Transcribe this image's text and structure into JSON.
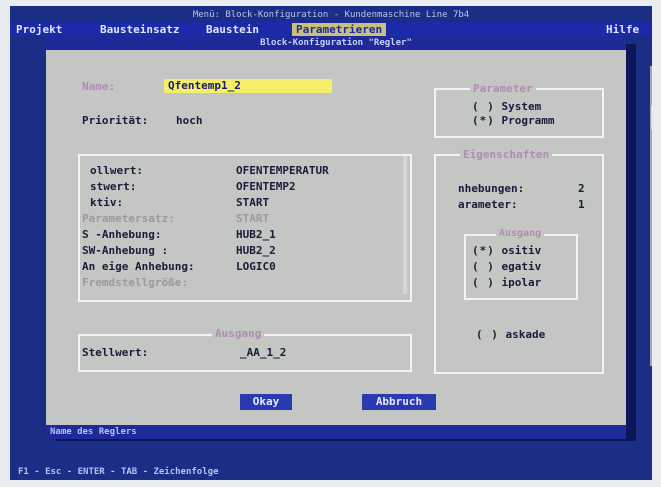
{
  "window": {
    "title": "Menü: Block-Konfiguration - Kundenmaschine Line 7b4"
  },
  "menubar": {
    "items": [
      "Projekt",
      "Bausteinsatz",
      "Baustein",
      "Parametrieren",
      "Hilfe"
    ]
  },
  "dialog": {
    "title": "Block-Konfiguration \"Regler\"",
    "name_label": "Name:",
    "name_value": "Qfentemp1_2",
    "prioritaet_label": "Priorität:",
    "prioritaet_value": "hoch",
    "parameter": {
      "title": "Parameter",
      "options": [
        {
          "mark": "( )",
          "label": "System"
        },
        {
          "mark": "(*)",
          "label": "Programm"
        }
      ]
    },
    "eigenschaften": {
      "title": "Eigenschaften",
      "rows": [
        {
          "label": "nhebungen:",
          "value": "2"
        },
        {
          "label": "arameter:",
          "value": "1"
        }
      ],
      "ausgang_title": "Ausgang",
      "ausgang_options": [
        {
          "mark": "(*)",
          "label": "ositiv"
        },
        {
          "mark": "( )",
          "label": "egativ"
        },
        {
          "mark": "( )",
          "label": "ipolar"
        }
      ],
      "kaskade": {
        "mark": "( )",
        "label": "askade"
      }
    },
    "eingang": {
      "rows": [
        {
          "label": "ollwert:",
          "value": "OFENTEMPERATUR",
          "dim": false
        },
        {
          "label": "stwert:",
          "value": "OFENTEMP2",
          "dim": false
        },
        {
          "label": "ktiv:",
          "value": "START",
          "dim": false
        },
        {
          "label": "Parametersatz:",
          "value": "START",
          "dim": true
        },
        {
          "label": "S -Anhebung:",
          "value": "HUB2_1",
          "dim": false
        },
        {
          "label": "SW-Anhebung :",
          "value": "HUB2_2",
          "dim": false
        },
        {
          "label": "An eige Anhebung:",
          "value": "LOGIC0",
          "dim": false
        },
        {
          "label": "Fremdstellgröße:",
          "value": "",
          "dim": true
        }
      ]
    },
    "ausgang_box": {
      "title": "Ausgang",
      "label": "Stellwert:",
      "value": "_AA_1_2"
    },
    "buttons": {
      "okay": "Okay",
      "abbruch": "Abbruch"
    },
    "status": "Name des Reglers"
  },
  "bottombar": {
    "text": "F1 - Esc - ENTER - TAB - Zeichenfolge"
  }
}
